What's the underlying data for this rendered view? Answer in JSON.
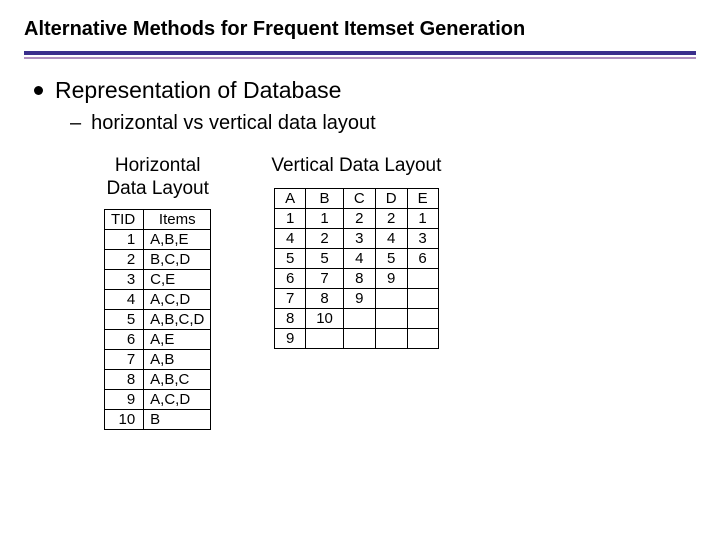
{
  "title": "Alternative Methods for Frequent Itemset Generation",
  "bullet1": "Representation of Database",
  "sub1": "horizontal vs vertical data layout",
  "horizontal": {
    "label1": "Horizontal",
    "label2": "Data Layout",
    "headers": {
      "c0": "TID",
      "c1": "Items"
    },
    "rows": [
      {
        "tid": "1",
        "items": "A,B,E"
      },
      {
        "tid": "2",
        "items": "B,C,D"
      },
      {
        "tid": "3",
        "items": "C,E"
      },
      {
        "tid": "4",
        "items": "A,C,D"
      },
      {
        "tid": "5",
        "items": "A,B,C,D"
      },
      {
        "tid": "6",
        "items": "A,E"
      },
      {
        "tid": "7",
        "items": "A,B"
      },
      {
        "tid": "8",
        "items": "A,B,C"
      },
      {
        "tid": "9",
        "items": "A,C,D"
      },
      {
        "tid": "10",
        "items": "B"
      }
    ]
  },
  "vertical": {
    "label": "Vertical Data Layout",
    "headers": {
      "c0": "A",
      "c1": "B",
      "c2": "C",
      "c3": "D",
      "c4": "E"
    },
    "rows": [
      {
        "a": "1",
        "b": "1",
        "c": "2",
        "d": "2",
        "e": "1"
      },
      {
        "a": "4",
        "b": "2",
        "c": "3",
        "d": "4",
        "e": "3"
      },
      {
        "a": "5",
        "b": "5",
        "c": "4",
        "d": "5",
        "e": "6"
      },
      {
        "a": "6",
        "b": "7",
        "c": "8",
        "d": "9",
        "e": ""
      },
      {
        "a": "7",
        "b": "8",
        "c": "9",
        "d": "",
        "e": ""
      },
      {
        "a": "8",
        "b": "10",
        "c": "",
        "d": "",
        "e": ""
      },
      {
        "a": "9",
        "b": "",
        "c": "",
        "d": "",
        "e": ""
      }
    ]
  }
}
